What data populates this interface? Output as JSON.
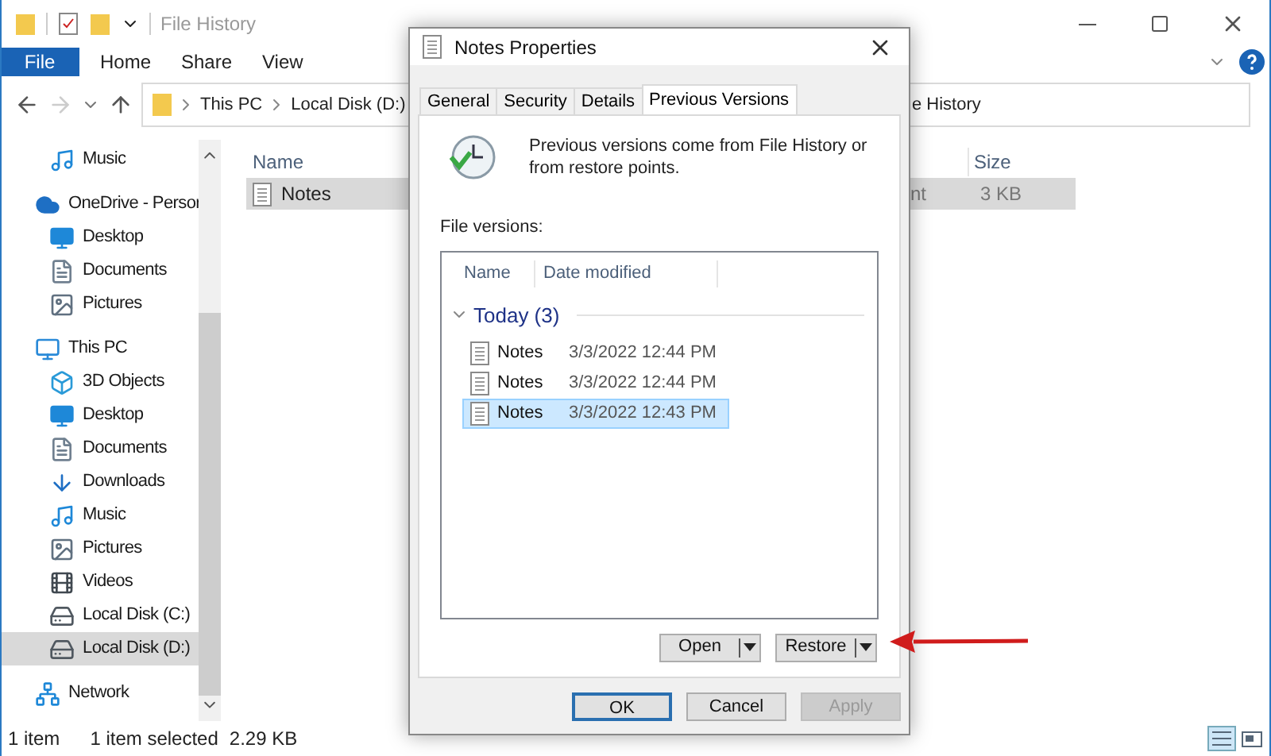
{
  "explorer": {
    "title": "File History",
    "ribbon_tabs": [
      {
        "label": "File",
        "kind": "file"
      },
      {
        "label": "Home",
        "kind": "tab"
      },
      {
        "label": "Share",
        "kind": "tab"
      },
      {
        "label": "View",
        "kind": "tab"
      }
    ],
    "address": {
      "segments": [
        "This PC",
        "Local Disk (D:)"
      ],
      "trailing_text": "e History"
    },
    "sidebar": {
      "continued_items": [
        {
          "label": "Music",
          "kind": "music",
          "selected": false
        }
      ],
      "items": [
        {
          "label": "OneDrive - Persor",
          "kind": "cloud",
          "selected": false,
          "children": [
            {
              "label": "Desktop",
              "kind": "desktop",
              "selected": false
            },
            {
              "label": "Documents",
              "kind": "documents",
              "selected": false
            },
            {
              "label": "Pictures",
              "kind": "pictures",
              "selected": false
            }
          ]
        },
        {
          "label": "This PC",
          "kind": "pc",
          "selected": false,
          "children": [
            {
              "label": "3D Objects",
              "kind": "cube",
              "selected": false
            },
            {
              "label": "Desktop",
              "kind": "desktop",
              "selected": false
            },
            {
              "label": "Documents",
              "kind": "documents",
              "selected": false
            },
            {
              "label": "Downloads",
              "kind": "downloads",
              "selected": false
            },
            {
              "label": "Music",
              "kind": "music",
              "selected": false
            },
            {
              "label": "Pictures",
              "kind": "pictures",
              "selected": false
            },
            {
              "label": "Videos",
              "kind": "videos",
              "selected": false
            },
            {
              "label": "Local Disk (C:)",
              "kind": "drive",
              "selected": false
            },
            {
              "label": "Local Disk (D:)",
              "kind": "drive",
              "selected": true
            }
          ]
        },
        {
          "label": "Network",
          "kind": "network",
          "selected": false
        }
      ]
    },
    "columns": [
      "Name",
      "Size"
    ],
    "rows": [
      {
        "name": "Notes",
        "column_3": "nt",
        "size": "3 KB",
        "selected": true
      }
    ],
    "status_bar": {
      "count": "1 item",
      "selection": "1 item selected",
      "size": "2.29 KB"
    }
  },
  "dialog": {
    "title": "Notes Properties",
    "tabs": [
      {
        "label": "General",
        "selected": false
      },
      {
        "label": "Security",
        "selected": false
      },
      {
        "label": "Details",
        "selected": false
      },
      {
        "label": "Previous Versions",
        "selected": true
      }
    ],
    "description": "Previous versions come from File History or from restore points.",
    "list_label": "File versions:",
    "columns": [
      "Name",
      "Date modified"
    ],
    "group": {
      "label": "Today (3)",
      "expanded": true
    },
    "versions": [
      {
        "name": "Notes",
        "date": "3/3/2022 12:44 PM",
        "selected": false
      },
      {
        "name": "Notes",
        "date": "3/3/2022 12:44 PM",
        "selected": false
      },
      {
        "name": "Notes",
        "date": "3/3/2022 12:43 PM",
        "selected": true
      }
    ],
    "actions": [
      {
        "label": "Open"
      },
      {
        "label": "Restore"
      }
    ],
    "buttons": [
      {
        "label": "OK",
        "default": true,
        "disabled": false
      },
      {
        "label": "Cancel",
        "default": false,
        "disabled": false
      },
      {
        "label": "Apply",
        "default": false,
        "disabled": true
      }
    ]
  }
}
